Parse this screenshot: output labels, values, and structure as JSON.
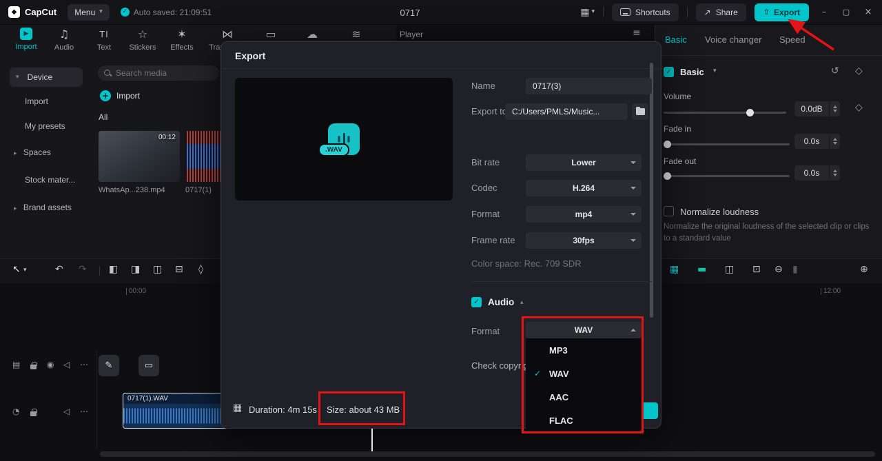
{
  "icons": {
    "logo_mark": "◆",
    "check": "✓",
    "caret_down": "▾",
    "caret_up": "▴",
    "caret_right": "▸",
    "grid": "▦",
    "share": "↗",
    "minimize": "–",
    "maximize": "▢",
    "close": "×",
    "hamburger": "≡",
    "plus": "+",
    "reset": "↺",
    "diamond": "◇",
    "cursor": "↖",
    "undo": "↶",
    "redo": "↷",
    "split_left": "◧",
    "split_right": "◨",
    "split_both": "◫",
    "delete": "⊟",
    "mirror": "◊",
    "snap": "▦",
    "link": "▬",
    "preview_axis": "◫",
    "mask": "⊡",
    "zoom_out": "⊖",
    "zoom_level": "▮",
    "zoom_in": "⊕",
    "collapse": "▤",
    "eye": "◉",
    "speaker": "◁",
    "more": "⋯",
    "pencil": "✎",
    "text_box": "▭",
    "record": "◔",
    "film": "▦",
    "note": "♫",
    "text_tool": "TI",
    "sticker": "☆",
    "effects": "✶",
    "transitions": "⋈",
    "captions": "▭",
    "cloud": "☁",
    "adjust": "≋",
    "play": "▶",
    "export_arrow": "⇧"
  },
  "topbar": {
    "logo": "CapCut",
    "menu": "Menu",
    "autosave": "Auto saved: 21:09:51",
    "title": "0717",
    "shortcuts": "Shortcuts",
    "share": "Share",
    "export": "Export"
  },
  "toolstrip": {
    "items": [
      "Import",
      "Audio",
      "Text",
      "Stickers",
      "Effects",
      "Transitions",
      "Captions",
      "Filters",
      "Adjustment"
    ]
  },
  "sidebar": {
    "items": [
      "Device",
      "Import",
      "My presets",
      "Spaces",
      "Stock mater...",
      "Brand assets"
    ]
  },
  "media": {
    "search_placeholder": "Search media",
    "import_label": "Import",
    "filter_all": "All",
    "video_label": "WhatsAp...238.mp4",
    "video_duration": "00:12",
    "audio_label": "0717(1)"
  },
  "player": {
    "title": "Player"
  },
  "inspector": {
    "tabs": [
      "Basic",
      "Voice changer",
      "Speed"
    ],
    "section_label": "Basic",
    "volume_label": "Volume",
    "volume_value": "0.0dB",
    "fade_in_label": "Fade in",
    "fade_in_value": "0.0s",
    "fade_out_label": "Fade out",
    "fade_out_value": "0.0s",
    "normalize_label": "Normalize loudness",
    "normalize_desc": "Normalize the original loudness of the selected clip or clips to a standard value"
  },
  "export_dialog": {
    "title": "Export",
    "file_badge": ".WAV",
    "name_label": "Name",
    "name_value": "0717(3)",
    "export_to_label": "Export to",
    "export_to_value": "C:/Users/PMLS/Music...",
    "bit_rate_label": "Bit rate",
    "bit_rate_value": "Lower",
    "codec_label": "Codec",
    "codec_value": "H.264",
    "format_label": "Format",
    "format_value": "mp4",
    "frame_rate_label": "Frame rate",
    "frame_rate_value": "30fps",
    "color_space": "Color space: Rec. 709 SDR",
    "audio_section_label": "Audio",
    "audio_format_label": "Format",
    "audio_format_value": "WAV",
    "audio_format_options": [
      "MP3",
      "WAV",
      "AAC",
      "FLAC"
    ],
    "selected_format": "WAV",
    "copyright_label": "Check copyright",
    "duration": "Duration: 4m 15s",
    "size": "Size: about 43 MB"
  },
  "timeline": {
    "ruler_start": "00:00",
    "ruler_end": "12:00",
    "clip_label": "0717(1).WAV"
  }
}
